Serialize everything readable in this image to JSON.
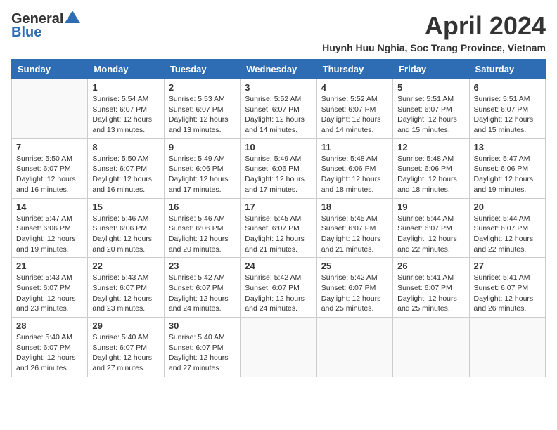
{
  "header": {
    "logo_line1": "General",
    "logo_line2": "Blue",
    "title": "April 2024",
    "subtitle": "Huynh Huu Nghia, Soc Trang Province, Vietnam"
  },
  "days": [
    "Sunday",
    "Monday",
    "Tuesday",
    "Wednesday",
    "Thursday",
    "Friday",
    "Saturday"
  ],
  "weeks": [
    [
      {
        "date": "",
        "sunrise": "",
        "sunset": "",
        "daylight": ""
      },
      {
        "date": "1",
        "sunrise": "Sunrise: 5:54 AM",
        "sunset": "Sunset: 6:07 PM",
        "daylight": "Daylight: 12 hours and 13 minutes."
      },
      {
        "date": "2",
        "sunrise": "Sunrise: 5:53 AM",
        "sunset": "Sunset: 6:07 PM",
        "daylight": "Daylight: 12 hours and 13 minutes."
      },
      {
        "date": "3",
        "sunrise": "Sunrise: 5:52 AM",
        "sunset": "Sunset: 6:07 PM",
        "daylight": "Daylight: 12 hours and 14 minutes."
      },
      {
        "date": "4",
        "sunrise": "Sunrise: 5:52 AM",
        "sunset": "Sunset: 6:07 PM",
        "daylight": "Daylight: 12 hours and 14 minutes."
      },
      {
        "date": "5",
        "sunrise": "Sunrise: 5:51 AM",
        "sunset": "Sunset: 6:07 PM",
        "daylight": "Daylight: 12 hours and 15 minutes."
      },
      {
        "date": "6",
        "sunrise": "Sunrise: 5:51 AM",
        "sunset": "Sunset: 6:07 PM",
        "daylight": "Daylight: 12 hours and 15 minutes."
      }
    ],
    [
      {
        "date": "7",
        "sunrise": "Sunrise: 5:50 AM",
        "sunset": "Sunset: 6:07 PM",
        "daylight": "Daylight: 12 hours and 16 minutes."
      },
      {
        "date": "8",
        "sunrise": "Sunrise: 5:50 AM",
        "sunset": "Sunset: 6:07 PM",
        "daylight": "Daylight: 12 hours and 16 minutes."
      },
      {
        "date": "9",
        "sunrise": "Sunrise: 5:49 AM",
        "sunset": "Sunset: 6:06 PM",
        "daylight": "Daylight: 12 hours and 17 minutes."
      },
      {
        "date": "10",
        "sunrise": "Sunrise: 5:49 AM",
        "sunset": "Sunset: 6:06 PM",
        "daylight": "Daylight: 12 hours and 17 minutes."
      },
      {
        "date": "11",
        "sunrise": "Sunrise: 5:48 AM",
        "sunset": "Sunset: 6:06 PM",
        "daylight": "Daylight: 12 hours and 18 minutes."
      },
      {
        "date": "12",
        "sunrise": "Sunrise: 5:48 AM",
        "sunset": "Sunset: 6:06 PM",
        "daylight": "Daylight: 12 hours and 18 minutes."
      },
      {
        "date": "13",
        "sunrise": "Sunrise: 5:47 AM",
        "sunset": "Sunset: 6:06 PM",
        "daylight": "Daylight: 12 hours and 19 minutes."
      }
    ],
    [
      {
        "date": "14",
        "sunrise": "Sunrise: 5:47 AM",
        "sunset": "Sunset: 6:06 PM",
        "daylight": "Daylight: 12 hours and 19 minutes."
      },
      {
        "date": "15",
        "sunrise": "Sunrise: 5:46 AM",
        "sunset": "Sunset: 6:06 PM",
        "daylight": "Daylight: 12 hours and 20 minutes."
      },
      {
        "date": "16",
        "sunrise": "Sunrise: 5:46 AM",
        "sunset": "Sunset: 6:06 PM",
        "daylight": "Daylight: 12 hours and 20 minutes."
      },
      {
        "date": "17",
        "sunrise": "Sunrise: 5:45 AM",
        "sunset": "Sunset: 6:07 PM",
        "daylight": "Daylight: 12 hours and 21 minutes."
      },
      {
        "date": "18",
        "sunrise": "Sunrise: 5:45 AM",
        "sunset": "Sunset: 6:07 PM",
        "daylight": "Daylight: 12 hours and 21 minutes."
      },
      {
        "date": "19",
        "sunrise": "Sunrise: 5:44 AM",
        "sunset": "Sunset: 6:07 PM",
        "daylight": "Daylight: 12 hours and 22 minutes."
      },
      {
        "date": "20",
        "sunrise": "Sunrise: 5:44 AM",
        "sunset": "Sunset: 6:07 PM",
        "daylight": "Daylight: 12 hours and 22 minutes."
      }
    ],
    [
      {
        "date": "21",
        "sunrise": "Sunrise: 5:43 AM",
        "sunset": "Sunset: 6:07 PM",
        "daylight": "Daylight: 12 hours and 23 minutes."
      },
      {
        "date": "22",
        "sunrise": "Sunrise: 5:43 AM",
        "sunset": "Sunset: 6:07 PM",
        "daylight": "Daylight: 12 hours and 23 minutes."
      },
      {
        "date": "23",
        "sunrise": "Sunrise: 5:42 AM",
        "sunset": "Sunset: 6:07 PM",
        "daylight": "Daylight: 12 hours and 24 minutes."
      },
      {
        "date": "24",
        "sunrise": "Sunrise: 5:42 AM",
        "sunset": "Sunset: 6:07 PM",
        "daylight": "Daylight: 12 hours and 24 minutes."
      },
      {
        "date": "25",
        "sunrise": "Sunrise: 5:42 AM",
        "sunset": "Sunset: 6:07 PM",
        "daylight": "Daylight: 12 hours and 25 minutes."
      },
      {
        "date": "26",
        "sunrise": "Sunrise: 5:41 AM",
        "sunset": "Sunset: 6:07 PM",
        "daylight": "Daylight: 12 hours and 25 minutes."
      },
      {
        "date": "27",
        "sunrise": "Sunrise: 5:41 AM",
        "sunset": "Sunset: 6:07 PM",
        "daylight": "Daylight: 12 hours and 26 minutes."
      }
    ],
    [
      {
        "date": "28",
        "sunrise": "Sunrise: 5:40 AM",
        "sunset": "Sunset: 6:07 PM",
        "daylight": "Daylight: 12 hours and 26 minutes."
      },
      {
        "date": "29",
        "sunrise": "Sunrise: 5:40 AM",
        "sunset": "Sunset: 6:07 PM",
        "daylight": "Daylight: 12 hours and 27 minutes."
      },
      {
        "date": "30",
        "sunrise": "Sunrise: 5:40 AM",
        "sunset": "Sunset: 6:07 PM",
        "daylight": "Daylight: 12 hours and 27 minutes."
      },
      {
        "date": "",
        "sunrise": "",
        "sunset": "",
        "daylight": ""
      },
      {
        "date": "",
        "sunrise": "",
        "sunset": "",
        "daylight": ""
      },
      {
        "date": "",
        "sunrise": "",
        "sunset": "",
        "daylight": ""
      },
      {
        "date": "",
        "sunrise": "",
        "sunset": "",
        "daylight": ""
      }
    ]
  ]
}
